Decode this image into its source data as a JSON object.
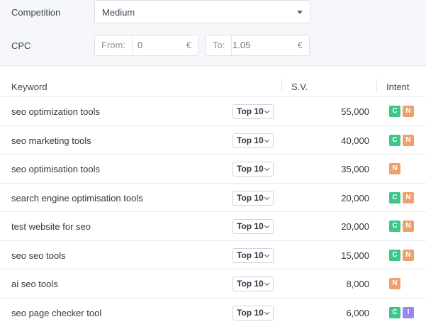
{
  "filters": {
    "competition": {
      "label": "Competition",
      "value": "Medium"
    },
    "cpc": {
      "label": "CPC",
      "from_prefix": "From:",
      "from_placeholder": "0",
      "to_prefix": "To:",
      "to_placeholder": "1.05",
      "currency": "€"
    }
  },
  "table": {
    "columns": {
      "keyword": "Keyword",
      "sv": "S.V.",
      "intent": "Intent"
    },
    "rows": [
      {
        "keyword": "seo optimization tools",
        "position": "Top 10",
        "sv": "55,000",
        "intents": [
          "C",
          "N"
        ]
      },
      {
        "keyword": "seo marketing tools",
        "position": "Top 10",
        "sv": "40,000",
        "intents": [
          "C",
          "N"
        ]
      },
      {
        "keyword": "seo optimisation tools",
        "position": "Top 10",
        "sv": "35,000",
        "intents": [
          "N"
        ]
      },
      {
        "keyword": "search engine optimisation tools",
        "position": "Top 10",
        "sv": "20,000",
        "intents": [
          "C",
          "N"
        ]
      },
      {
        "keyword": "test website for seo",
        "position": "Top 10",
        "sv": "20,000",
        "intents": [
          "C",
          "N"
        ]
      },
      {
        "keyword": "seo seo tools",
        "position": "Top 10",
        "sv": "15,000",
        "intents": [
          "C",
          "N"
        ]
      },
      {
        "keyword": "ai seo tools",
        "position": "Top 10",
        "sv": "8,000",
        "intents": [
          "N"
        ]
      },
      {
        "keyword": "seo page checker tool",
        "position": "Top 10",
        "sv": "6,000",
        "intents": [
          "C",
          "I"
        ]
      }
    ]
  },
  "colors": {
    "intent_C": "#3cc68a",
    "intent_N": "#f0a06b",
    "intent_I": "#9b84f0"
  }
}
